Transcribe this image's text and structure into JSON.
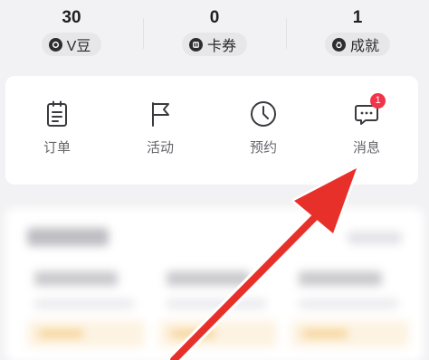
{
  "stats": [
    {
      "value": "30",
      "label": "V豆",
      "icon": "v-bean-icon"
    },
    {
      "value": "0",
      "label": "卡券",
      "icon": "coupon-icon"
    },
    {
      "value": "1",
      "label": "成就",
      "icon": "achievement-icon"
    }
  ],
  "menu": {
    "orders": {
      "label": "订单",
      "icon": "order-icon"
    },
    "activities": {
      "label": "活动",
      "icon": "flag-icon"
    },
    "reservations": {
      "label": "预约",
      "icon": "clock-icon"
    },
    "messages": {
      "label": "消息",
      "icon": "chat-icon",
      "badge": "1"
    }
  },
  "colors": {
    "background": "#f2f2f4",
    "card": "#ffffff",
    "badge": "#f2334a",
    "annotation_arrow": "#e8302a"
  }
}
